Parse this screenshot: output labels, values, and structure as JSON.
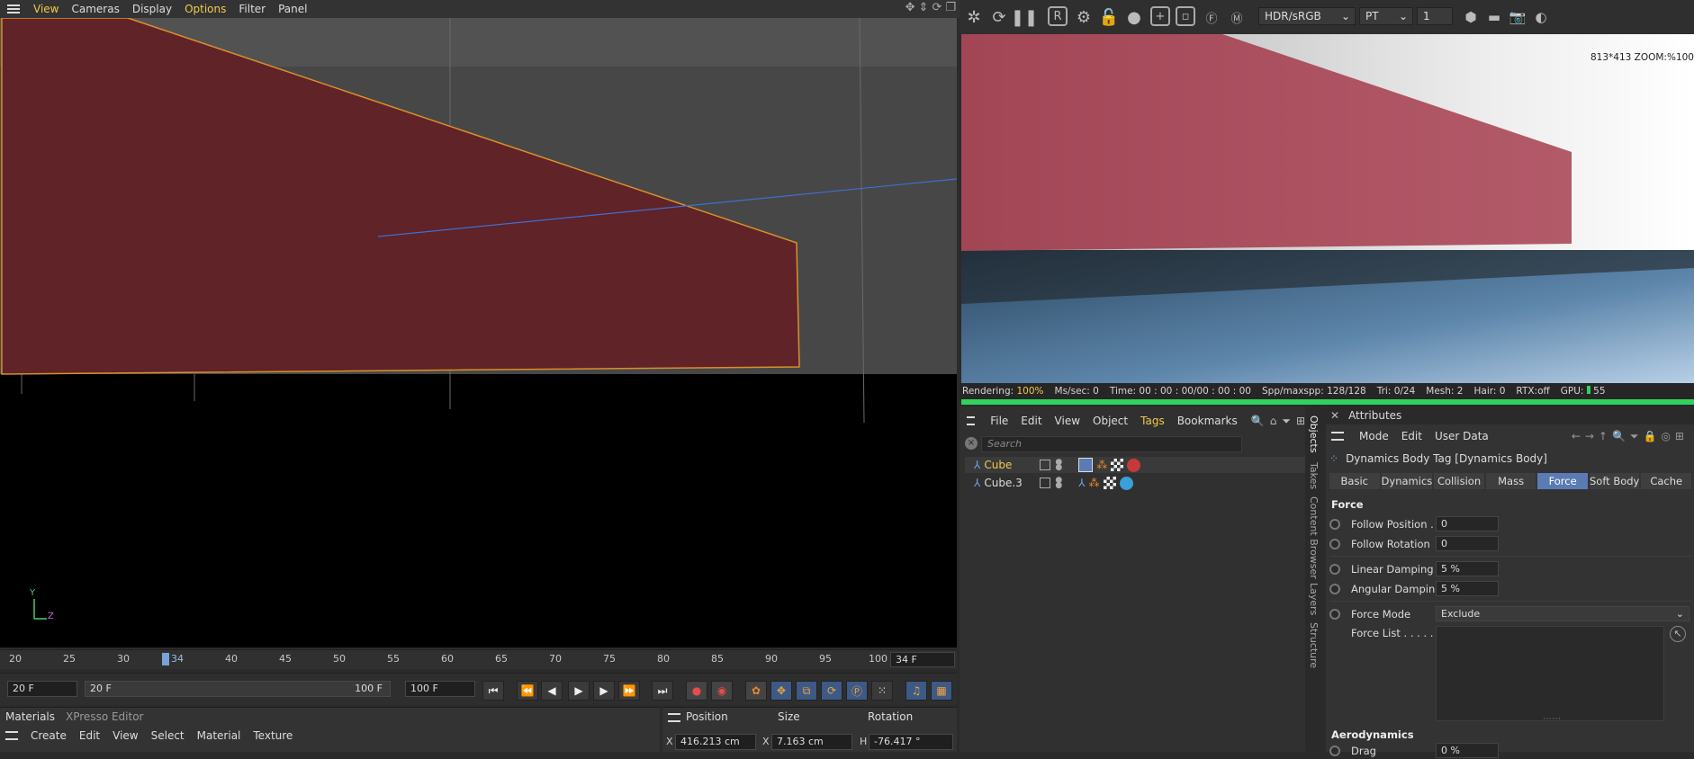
{
  "viewport": {
    "menu": [
      "View",
      "Cameras",
      "Display",
      "Options",
      "Filter",
      "Panel"
    ],
    "axis_y": "Y",
    "axis_z": "Z"
  },
  "timeline": {
    "ticks": [
      "20",
      "25",
      "30",
      "34",
      "40",
      "45",
      "50",
      "55",
      "60",
      "65",
      "70",
      "75",
      "80",
      "85",
      "90",
      "95",
      "100"
    ],
    "current_frame": "34 F"
  },
  "transport": {
    "start_frame": "20 F",
    "range_start": "20 F",
    "range_end": "100 F",
    "end_frame": "100 F"
  },
  "materials": {
    "tabs": [
      "Materials",
      "XPresso Editor"
    ],
    "menu": [
      "Create",
      "Edit",
      "View",
      "Select",
      "Material",
      "Texture"
    ]
  },
  "coords": {
    "headers": [
      "Position",
      "Size",
      "Rotation"
    ],
    "row": {
      "label1": "X",
      "position": "416.213 cm",
      "label2": "X",
      "size": "7.163 cm",
      "label3": "H",
      "rotation": "-76.417 °"
    }
  },
  "render": {
    "color_mode": "HDR/sRGB",
    "kernel": "PT",
    "spin_value": "1",
    "zoom_info": "813*413 ZOOM:%100",
    "status": {
      "rendering_label": "Rendering:",
      "rendering_value": "100%",
      "ms": "Ms/sec: 0",
      "time": "Time: 00 : 00 : 00/00 : 00 : 00",
      "spp": "Spp/maxspp: 128/128",
      "tri": "Tri: 0/24",
      "mesh": "Mesh: 2",
      "hair": "Hair: 0",
      "rtx": "RTX:off",
      "gpu": "GPU:",
      "gpu_value": "55"
    }
  },
  "objects": {
    "menu": [
      "File",
      "Edit",
      "View",
      "Object",
      "Tags",
      "Bookmarks"
    ],
    "search_placeholder": "Search",
    "rows": [
      {
        "name": "Cube",
        "selected": true
      },
      {
        "name": "Cube.3",
        "selected": false
      }
    ]
  },
  "side_tabs": [
    "Objects",
    "Takes",
    "Content Browser",
    "Layers",
    "Structure"
  ],
  "attributes": {
    "title": "Attributes",
    "menu": [
      "Mode",
      "Edit",
      "User Data"
    ],
    "tag_title": "Dynamics Body Tag [Dynamics Body]",
    "tabs": [
      "Basic",
      "Dynamics",
      "Collision",
      "Mass",
      "Force",
      "Soft Body",
      "Cache"
    ],
    "active_tab": "Force",
    "section": "Force",
    "follow_position_label": "Follow Position .",
    "follow_position_value": "0",
    "follow_rotation_label": "Follow Rotation",
    "follow_rotation_value": "0",
    "linear_damping_label": "Linear Damping",
    "linear_damping_value": "5 %",
    "angular_damping_label": "Angular Damping",
    "angular_damping_value": "5 %",
    "force_mode_label": "Force Mode",
    "force_mode_value": "Exclude",
    "force_list_label": "Force List . . . . .",
    "aero_section": "Aerodynamics",
    "drag_label": "Drag",
    "drag_value": "0 %"
  },
  "colors": {
    "accent": "#5b7bb5",
    "highlight": "#f2c94c",
    "progress": "#2fd35b"
  }
}
